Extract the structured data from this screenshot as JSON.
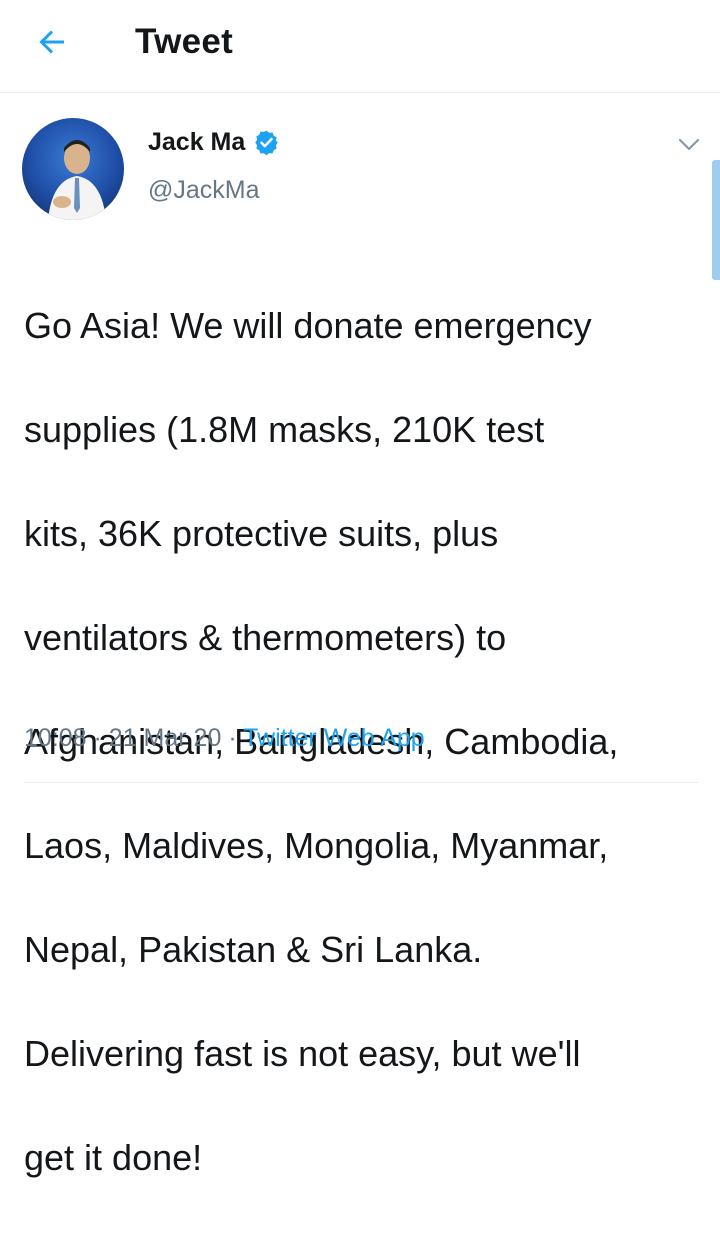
{
  "header": {
    "title": "Tweet",
    "back_icon": "back-arrow-icon"
  },
  "tweet": {
    "author": {
      "name": "Jack Ma",
      "handle": "@JackMa",
      "verified": true,
      "avatar_icon": "avatar-photo"
    },
    "text_lines": [
      "Go Asia! We will donate emergency",
      "supplies (1.8M masks, 210K test",
      "kits, 36K protective suits, plus",
      "ventilators & thermometers) to",
      "Afghanistan, Bangladesh, Cambodia,",
      "Laos, Maldives, Mongolia, Myanmar,",
      "Nepal, Pakistan & Sri Lanka.",
      "Delivering fast is not easy, but we'll",
      "get it done!"
    ],
    "time": "10:08",
    "separator": "·",
    "date": "21 Mar 20",
    "source": "Twitter Web App"
  },
  "colors": {
    "accent": "#1da1f2",
    "secondary_text": "#657786",
    "divider": "#e6ecf0"
  }
}
